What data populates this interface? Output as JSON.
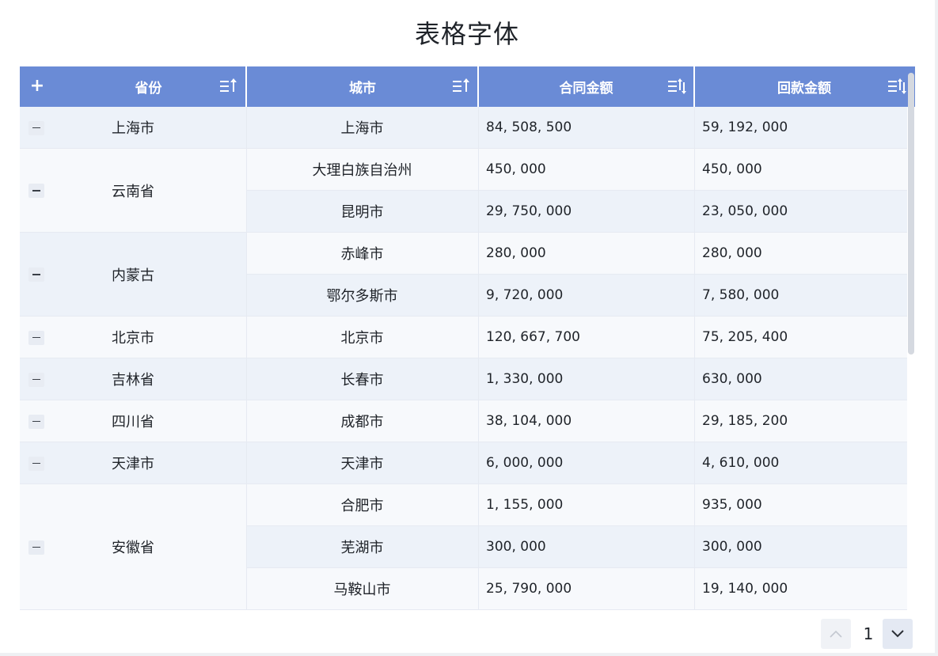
{
  "title": "表格字体",
  "columns": [
    {
      "key": "province",
      "label": "省份"
    },
    {
      "key": "city",
      "label": "城市"
    },
    {
      "key": "contract",
      "label": "合同金额"
    },
    {
      "key": "payback",
      "label": "回款金额"
    }
  ],
  "header_icons": {
    "expand_all": "plus-icon",
    "province_sort": "sort-ascending-icon",
    "city_sort": "sort-ascending-icon",
    "contract_sort": "sort-both-icon",
    "payback_sort": "sort-both-icon"
  },
  "groups": [
    {
      "province": "上海市",
      "rows": [
        {
          "city": "上海市",
          "contract": "84, 508, 500",
          "payback": "59, 192, 000"
        }
      ]
    },
    {
      "province": "云南省",
      "rows": [
        {
          "city": "大理白族自治州",
          "contract": "450, 000",
          "payback": "450, 000"
        },
        {
          "city": "昆明市",
          "contract": "29, 750, 000",
          "payback": "23, 050, 000"
        }
      ]
    },
    {
      "province": "内蒙古",
      "rows": [
        {
          "city": "赤峰市",
          "contract": "280, 000",
          "payback": "280, 000"
        },
        {
          "city": "鄂尔多斯市",
          "contract": "9, 720, 000",
          "payback": "7, 580, 000"
        }
      ]
    },
    {
      "province": "北京市",
      "rows": [
        {
          "city": "北京市",
          "contract": "120, 667, 700",
          "payback": "75, 205, 400"
        }
      ]
    },
    {
      "province": "吉林省",
      "rows": [
        {
          "city": "长春市",
          "contract": "1, 330, 000",
          "payback": "630, 000"
        }
      ]
    },
    {
      "province": "四川省",
      "rows": [
        {
          "city": "成都市",
          "contract": "38, 104, 000",
          "payback": "29, 185, 200"
        }
      ]
    },
    {
      "province": "天津市",
      "rows": [
        {
          "city": "天津市",
          "contract": "6, 000, 000",
          "payback": "4, 610, 000"
        }
      ]
    },
    {
      "province": "安徽省",
      "rows": [
        {
          "city": "合肥市",
          "contract": "1, 155, 000",
          "payback": "935, 000"
        },
        {
          "city": "芜湖市",
          "contract": "300, 000",
          "payback": "300, 000"
        },
        {
          "city": "马鞍山市",
          "contract": "25, 790, 000",
          "payback": "19, 140, 000"
        }
      ]
    }
  ],
  "pagination": {
    "current_page": "1"
  },
  "colors": {
    "header_bg": "#6a8bd6",
    "row_even": "#edf2f9",
    "row_odd": "#f7f9fc",
    "text": "#1f2329"
  }
}
